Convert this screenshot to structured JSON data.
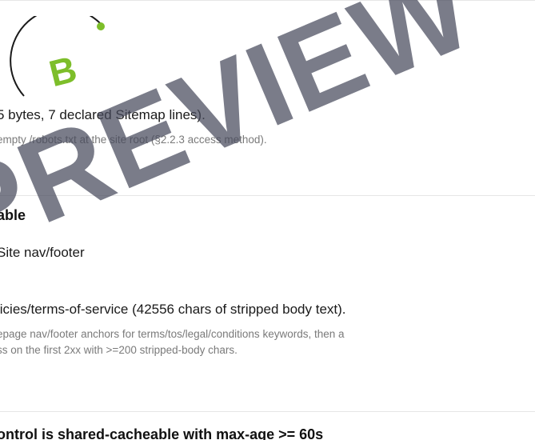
{
  "brand": {
    "logo_letter": "B",
    "logo_color": "#7dbe2a",
    "watermark_text": "PREVIEW",
    "watermark_color": "#464a5c"
  },
  "checks": [
    {
      "result": "5 bytes, 7 declared Sitemap lines).",
      "detail": "empty /robots.txt at the site root (§2.2.3 access method)."
    },
    {
      "heading": "able",
      "result": "Site nav/footer",
      "result2": "licies/terms-of-service (42556 chars of stripped body text).",
      "detail_lines": [
        "epage nav/footer anchors for terms/tos/legal/conditions keywords, then a",
        "ss on the first 2xx with >=200 stripped-body chars."
      ]
    },
    {
      "heading": "ontrol is shared-cacheable with max-age >= 60s"
    }
  ]
}
